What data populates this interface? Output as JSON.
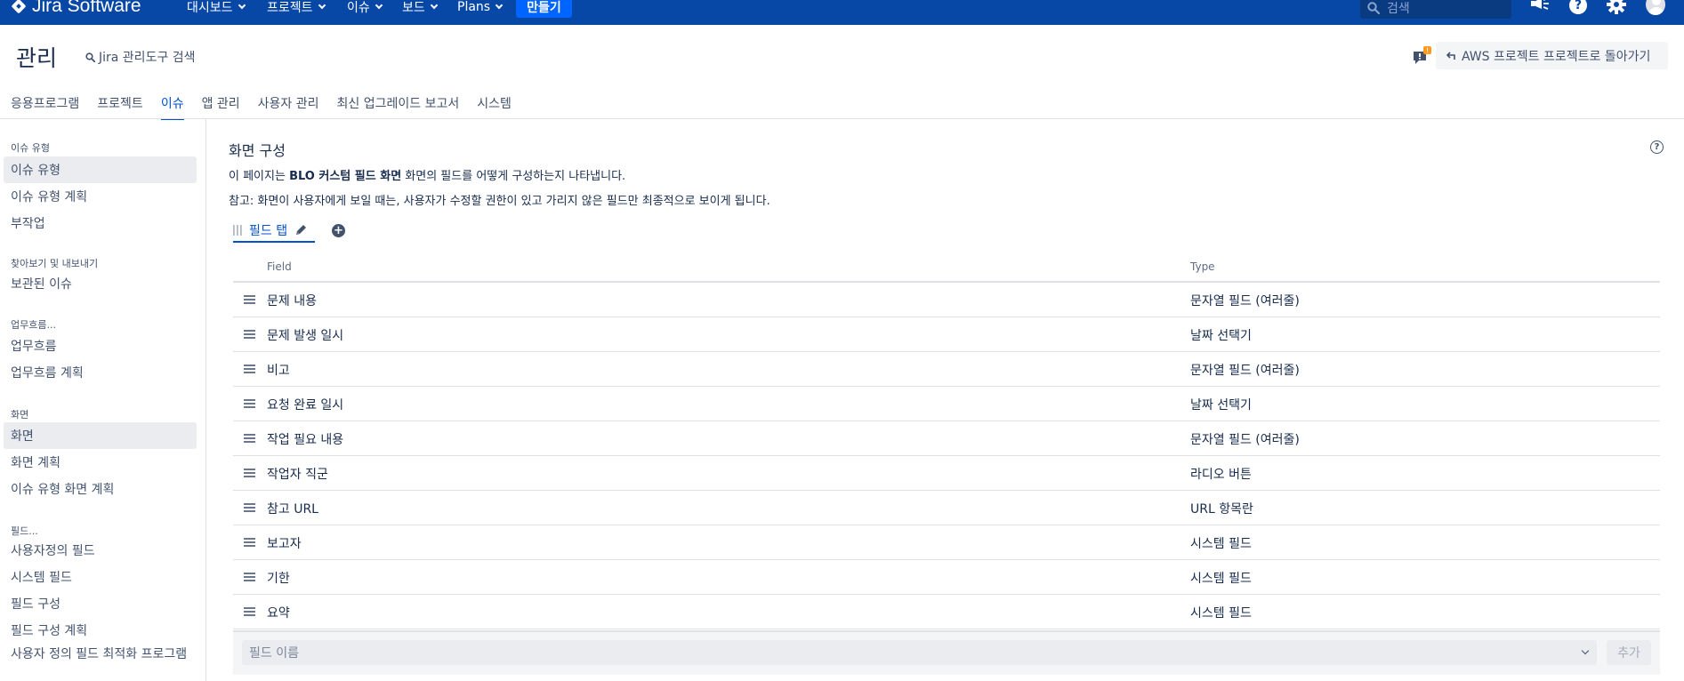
{
  "topnav": {
    "logo_text": "Jira Software",
    "items": [
      {
        "label": "대시보드"
      },
      {
        "label": "프로젝트"
      },
      {
        "label": "이슈"
      },
      {
        "label": "보드"
      },
      {
        "label": "Plans"
      }
    ],
    "create_label": "만들기",
    "search_placeholder": "검색",
    "icons": [
      "notifications-icon",
      "help-icon",
      "settings-icon",
      "avatar"
    ],
    "bg_color": "#0747a6",
    "accent_color": "#0065ff"
  },
  "admin": {
    "title": "관리",
    "search_label": "Jira 관리도구 검색",
    "feedback_badge": "!",
    "back_label": "AWS 프로젝트 프로젝트로 돌아가기"
  },
  "tabs": [
    {
      "label": "응용프로그램",
      "active": false
    },
    {
      "label": "프로젝트",
      "active": false
    },
    {
      "label": "이슈",
      "active": true
    },
    {
      "label": "앱 관리",
      "active": false
    },
    {
      "label": "사용자 관리",
      "active": false
    },
    {
      "label": "최신 업그레이드 보고서",
      "active": false
    },
    {
      "label": "시스템",
      "active": false
    }
  ],
  "sidebar": {
    "sections": [
      {
        "heading": "이슈 유형",
        "items": [
          {
            "label": "이슈 유형",
            "selected": true
          },
          {
            "label": "이슈 유형 계획",
            "selected": false
          },
          {
            "label": "부작업",
            "selected": false
          }
        ]
      },
      {
        "heading": "찾아보기 및 내보내기",
        "items": [
          {
            "label": "보관된 이슈",
            "selected": false
          }
        ]
      },
      {
        "heading": "업무흐름...",
        "items": [
          {
            "label": "업무흐름",
            "selected": false
          },
          {
            "label": "업무흐름 계획",
            "selected": false
          }
        ]
      },
      {
        "heading": "화면",
        "items": [
          {
            "label": "화면",
            "selected": true
          },
          {
            "label": "화면 계획",
            "selected": false
          },
          {
            "label": "이슈 유형 화면 계획",
            "selected": false
          }
        ]
      },
      {
        "heading": "필드...",
        "items": [
          {
            "label": "사용자정의 필드",
            "selected": false
          },
          {
            "label": "시스템 필드",
            "selected": false
          },
          {
            "label": "필드 구성",
            "selected": false
          },
          {
            "label": "필드 구성 계획",
            "selected": false
          },
          {
            "label": "사용자 정의 필드 최적화 프로그램",
            "selected": false
          }
        ]
      }
    ]
  },
  "main": {
    "title": "화면 구성",
    "help_label": "?",
    "desc_prefix": "이 페이지는 ",
    "desc_bold": "BLO 커스텀 필드 화면",
    "desc_suffix": " 화면의 필드를 어떻게 구성하는지 나타냅니다.",
    "note": "참고: 화면이 사용자에게 보일 때는, 사용자가 수정할 권한이 있고 가리지 않은 필드만 최종적으로 보이게 됩니다.",
    "screen_tab_label": "필드 탭",
    "add_tab_label": "+",
    "columns": {
      "field": "Field",
      "type": "Type"
    },
    "rows": [
      {
        "field": "문제 내용",
        "type": "문자열 필드 (여러줄)"
      },
      {
        "field": "문제 발생 일시",
        "type": "날짜 선택기"
      },
      {
        "field": "비고",
        "type": "문자열 필드 (여러줄)"
      },
      {
        "field": "요청 완료 일시",
        "type": "날짜 선택기"
      },
      {
        "field": "작업 필요 내용",
        "type": "문자열 필드 (여러줄)"
      },
      {
        "field": "작업자 직군",
        "type": "라디오 버튼"
      },
      {
        "field": "참고 URL",
        "type": "URL 항목란"
      },
      {
        "field": "보고자",
        "type": "시스템 필드"
      },
      {
        "field": "기한",
        "type": "시스템 필드"
      },
      {
        "field": "요약",
        "type": "시스템 필드"
      }
    ],
    "field_select_placeholder": "필드 이름",
    "add_button_label": "추가"
  }
}
